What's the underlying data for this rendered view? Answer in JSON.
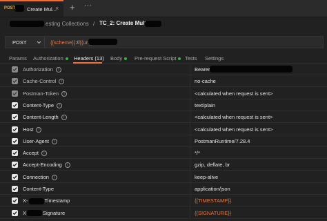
{
  "tab": {
    "method": "POST",
    "name": "Create Mul...",
    "close": "×",
    "new": "+",
    "more": "···"
  },
  "breadcrumb": {
    "collection": "esting Collections",
    "separator": "/",
    "request": "TC_2: Create Multiple"
  },
  "request": {
    "method": "POST",
    "url_var1": "{{scheme}}",
    "url_sep": "://",
    "url_var2": "{{url}}"
  },
  "subtabs": [
    {
      "label": "Params"
    },
    {
      "label": "Authorization",
      "dot": true
    },
    {
      "label": "Headers (13)",
      "active": true
    },
    {
      "label": "Body",
      "dot": true
    },
    {
      "label": "Pre-request Script",
      "dot": true
    },
    {
      "label": "Tests"
    },
    {
      "label": "Settings"
    }
  ],
  "headers": [
    {
      "key": "Authorization",
      "value": "Bearer",
      "checked": true,
      "auto": true,
      "info": true
    },
    {
      "key": "Cache-Control",
      "value": "no-cache",
      "checked": true,
      "auto": true,
      "info": true
    },
    {
      "key": "Postman-Token",
      "value": "<calculated when request is sent>",
      "checked": true,
      "auto": true,
      "info": true
    },
    {
      "key": "Content-Type",
      "value": "text/plain",
      "checked": true,
      "info": true
    },
    {
      "key": "Content-Length",
      "value": "<calculated when request is sent>",
      "checked": true,
      "info": true
    },
    {
      "key": "Host",
      "value": "<calculated when request is sent>",
      "checked": true,
      "info": true
    },
    {
      "key": "User-Agent",
      "value": "PostmanRuntime/7.28.4",
      "checked": true,
      "info": true
    },
    {
      "key": "Accept",
      "value": "*/*",
      "checked": true,
      "info": true
    },
    {
      "key": "Accept-Encoding",
      "value": "gzip, deflate, br",
      "checked": true,
      "info": true
    },
    {
      "key": "Connection",
      "value": "keep-alive",
      "checked": true,
      "info": true
    },
    {
      "key": "Content-Type",
      "value": "application/json",
      "checked": true
    },
    {
      "key": "X-",
      "key_suffix": "Timestamp",
      "value": "{{TIMESTAMP}}",
      "checked": true,
      "variable": true,
      "redacted_key": true
    },
    {
      "key": "X",
      "key_suffix": "Signature",
      "value": "{{SIGNATURE}}",
      "checked": true,
      "variable": true,
      "redacted_key": true
    }
  ],
  "colors": {
    "accent": "#f26b3a",
    "variable": "#e07a4c",
    "status_dot": "#37b24d",
    "background": "#212121"
  }
}
